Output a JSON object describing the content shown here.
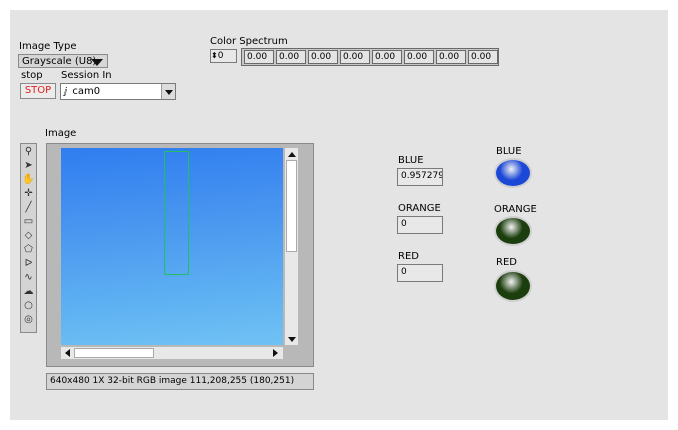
{
  "controls": {
    "image_type_label": "Image Type",
    "image_type_value": "Grayscale (U8)",
    "stop_label": "stop",
    "stop_button": "STOP",
    "session_label": "Session In",
    "session_value": "cam0",
    "session_icon": "ⅉ"
  },
  "spectrum": {
    "label": "Color Spectrum",
    "index": "0",
    "values": [
      "0.00",
      "0.00",
      "0.00",
      "0.00",
      "0.00",
      "0.00",
      "0.00",
      "0.00"
    ]
  },
  "image": {
    "label": "Image",
    "status": "640x480 1X 32-bit RGB image 111,208,255    (180,251)"
  },
  "indicators": {
    "blue_label": "BLUE",
    "blue_value": "0.957279",
    "orange_label": "ORANGE",
    "orange_value": "0",
    "red_label": "RED",
    "red_value": "0"
  },
  "leds": {
    "blue_label": "BLUE",
    "orange_label": "ORANGE",
    "red_label": "RED",
    "blue_color": "#1c48d8",
    "orange_color": "#1c3e0e",
    "red_color": "#1c3e0e"
  },
  "tools": [
    "zoom-icon",
    "pointer-icon",
    "pan-icon",
    "crosshair-icon",
    "line-icon",
    "rectangle-icon",
    "rotated-rectangle-icon",
    "polygon-icon",
    "broken-line-icon",
    "freehand-icon",
    "freehand-region-icon",
    "ellipse-icon",
    "annulus-icon"
  ]
}
